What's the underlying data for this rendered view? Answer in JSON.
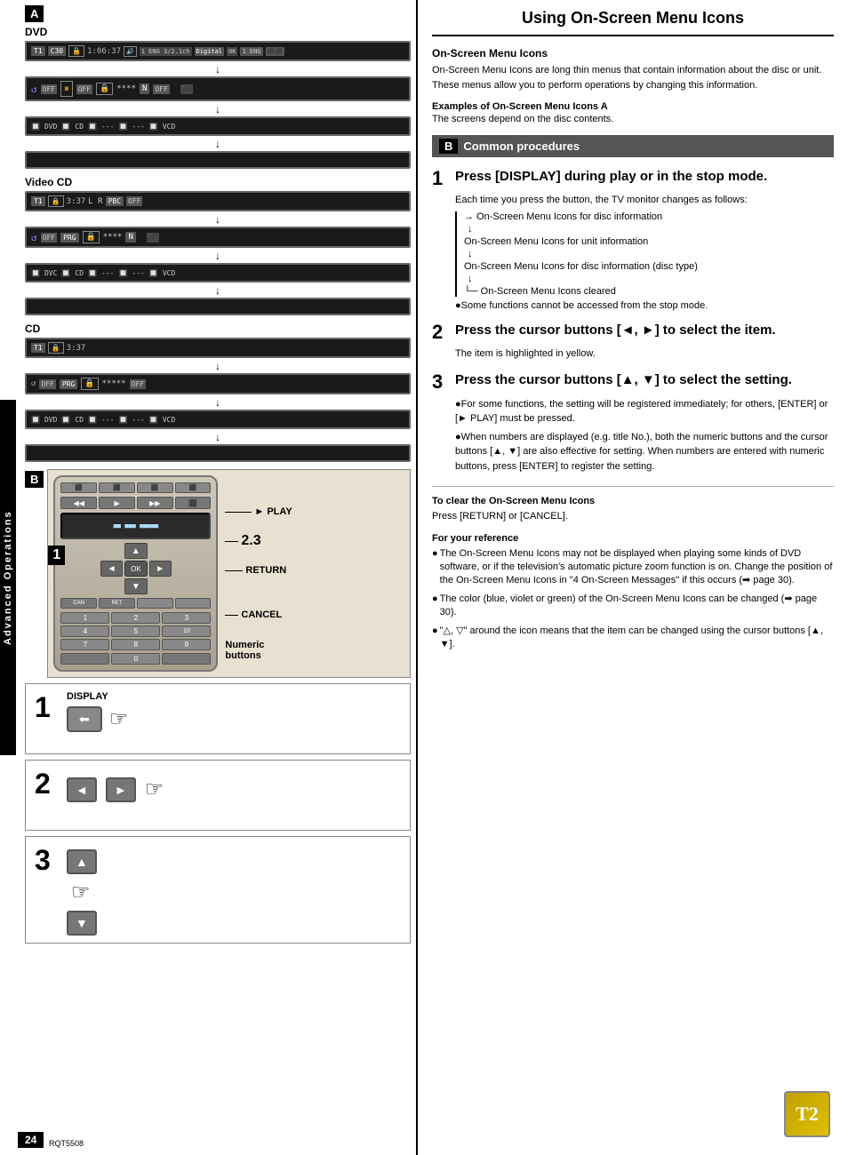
{
  "page": {
    "number": "24",
    "code": "RQT5508"
  },
  "left_panel": {
    "section_a_label": "A",
    "section_b_label": "B",
    "advanced_operations_label": "Advanced Operations",
    "dvd_section": {
      "title": "DVD",
      "row1": "T1 C30 🔒 1:06:37 🔊 1 ENG 3/2.1ch Digital 0K 1 ENG",
      "row2": "↺  OFF  ⏸OFF  🔒****  N  OFF",
      "row3": "DVD  CD  🎵  ---  ---  VCD"
    },
    "vcd_section": {
      "title": "Video CD",
      "row1": "T1  3:37  L R  PBC OFF",
      "row2": "↺  OFF  PRG  🔒****  N",
      "row3": "DVC  CD  🎵  ---  ---  VCD"
    },
    "cd_section": {
      "title": "CD",
      "row1": "T1  🔒  3:37",
      "row2": "↺  OFF  PRG  🔒*****  OFF",
      "row3": "DVD  CD  🎵  ---  ---  VCD"
    },
    "remote_labels": {
      "play": "► PLAY",
      "step_23": "2.3",
      "return": "RETURN",
      "cancel": "CANCEL",
      "numeric": "Numeric",
      "buttons": "buttons",
      "step1_label": "1"
    },
    "steps": {
      "step1_label": "1",
      "step1_button": "DISPLAY",
      "step2_label": "2",
      "step3_label": "3"
    }
  },
  "right_panel": {
    "title": "Using On-Screen Menu Icons",
    "on_screen_section": {
      "header": "On-Screen Menu Icons",
      "body": "On-Screen Menu Icons are long thin menus that contain information about the disc or unit. These menus allow you to perform operations by changing this information."
    },
    "examples_section": {
      "header": "Examples of On-Screen Menu Icons A",
      "body": "The screens depend on the disc contents."
    },
    "common_procedures": {
      "letter": "B",
      "title": "Common procedures"
    },
    "steps": [
      {
        "number": "1",
        "title": "Press [DISPLAY] during play or in the stop mode.",
        "desc": "Each time you press the button, the TV monitor changes as follows:",
        "flow": [
          "→ On-Screen Menu Icons for disc information",
          "↓",
          "On-Screen Menu Icons for unit information",
          "↓",
          "On-Screen Menu Icons for disc information (disc type)",
          "↓",
          "└─ On-Screen Menu Icons cleared"
        ],
        "note": "●Some functions cannot be accessed from the stop mode."
      },
      {
        "number": "2",
        "title": "Press the cursor buttons [◄, ►] to select the item.",
        "desc": "The item is highlighted in yellow."
      },
      {
        "number": "3",
        "title": "Press the cursor buttons [▲, ▼] to select the setting.",
        "bullets": [
          "●For some functions, the setting will be registered immediately; for others, [ENTER] or [► PLAY] must be pressed.",
          "●When numbers are displayed (e.g. title No.), both the numeric buttons and the cursor buttons [▲, ▼] are also effective for setting. When numbers are entered with numeric buttons, press [ENTER] to register the setting."
        ]
      }
    ],
    "clear_section": {
      "title": "To clear the On-Screen Menu Icons",
      "body": "Press [RETURN] or [CANCEL]."
    },
    "reference_section": {
      "title": "For your reference",
      "items": [
        "●The On-Screen Menu Icons may not be displayed when playing some kinds of DVD software, or if the television's automatic picture zoom function is on. Change the position of the On-Screen Menu Icons in \"4 On-Screen Messages\" if this occurs (➡ page 30).",
        "●The color (blue, violet or green) of the On-Screen Menu Icons can be changed (➡ page 30).",
        "●\"△, ▽\" around the icon means that the item can be changed using the cursor buttons [▲, ▼]."
      ]
    },
    "t2_icon": "T2"
  }
}
